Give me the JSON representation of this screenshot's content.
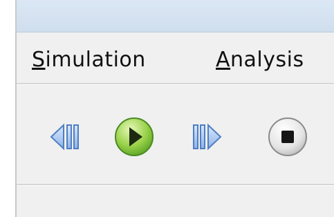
{
  "menubar": {
    "items": [
      {
        "mnemonic": "S",
        "rest": "imulation"
      },
      {
        "mnemonic": "A",
        "rest": "nalysis"
      }
    ]
  },
  "toolbar": {
    "buttons": [
      {
        "icon": "step-back-icon"
      },
      {
        "icon": "play-icon",
        "color": "#7cc23a"
      },
      {
        "icon": "step-forward-icon"
      },
      {
        "icon": "stop-icon"
      }
    ]
  },
  "colors": {
    "accent_blue": "#5b8ed6",
    "play_green": "#7cc23a",
    "titlebar": "#d4e2f1"
  }
}
